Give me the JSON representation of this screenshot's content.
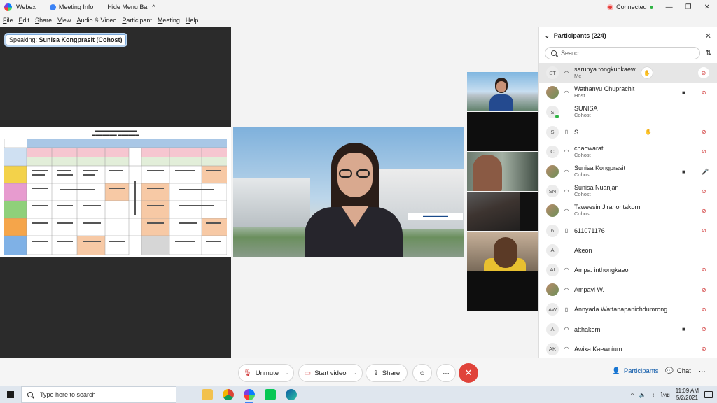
{
  "titlebar": {
    "app_name": "Webex",
    "meeting_info": "Meeting Info",
    "hide_menu_bar": "Hide Menu Bar",
    "status": "Connected",
    "status_color": "#2fb344"
  },
  "menu": [
    "File",
    "Edit",
    "Share",
    "View",
    "Audio & Video",
    "Participant",
    "Meeting",
    "Help"
  ],
  "stage": {
    "speaking_label": "Speaking:",
    "speaking_name": "Sunisa Kongprasit (Cohost)"
  },
  "participants": {
    "header": "Participants (224)",
    "search_placeholder": "Search",
    "items": [
      {
        "initials": "ST",
        "name": "sarunya tongkunkaew",
        "role": "Me",
        "device": "headset",
        "hand": true,
        "video": false,
        "mic": "muted"
      },
      {
        "initials": "",
        "name": "Wathanyu Chuprachit",
        "role": "Host",
        "device": "headset",
        "hand": false,
        "video": true,
        "mic": "muted"
      },
      {
        "initials": "S",
        "name": "SUNISA",
        "role": "Cohost",
        "device": "",
        "hand": false,
        "video": false,
        "mic": "none"
      },
      {
        "initials": "S",
        "name": "S",
        "role": "",
        "device": "phone",
        "hand": true,
        "video": false,
        "mic": "muted"
      },
      {
        "initials": "C",
        "name": "chaowarat",
        "role": "Cohost",
        "device": "headset",
        "hand": false,
        "video": false,
        "mic": "muted"
      },
      {
        "initials": "",
        "name": "Sunisa Kongprasit",
        "role": "Cohost",
        "device": "headset",
        "hand": false,
        "video": true,
        "mic": "on"
      },
      {
        "initials": "SN",
        "name": "Sunisa Nuanjan",
        "role": "Cohost",
        "device": "headset",
        "hand": false,
        "video": false,
        "mic": "muted"
      },
      {
        "initials": "",
        "name": "Taweesin Jiranontakorn",
        "role": "Cohost",
        "device": "headset",
        "hand": false,
        "video": false,
        "mic": "muted"
      },
      {
        "initials": "6",
        "name": "611071176",
        "role": "",
        "device": "phone",
        "hand": false,
        "video": false,
        "mic": "muted"
      },
      {
        "initials": "A",
        "name": "Akeon",
        "role": "",
        "device": "",
        "hand": false,
        "video": false,
        "mic": "none"
      },
      {
        "initials": "AI",
        "name": "Ampa. inthongkaeo",
        "role": "",
        "device": "headset",
        "hand": false,
        "video": false,
        "mic": "muted"
      },
      {
        "initials": "",
        "name": "Ampavi W.",
        "role": "",
        "device": "headset",
        "hand": false,
        "video": false,
        "mic": "muted"
      },
      {
        "initials": "AW",
        "name": "Annyada Wattanapanichdumrong",
        "role": "",
        "device": "phone",
        "hand": false,
        "video": false,
        "mic": "muted"
      },
      {
        "initials": "A",
        "name": "atthakorn",
        "role": "",
        "device": "headset",
        "hand": false,
        "video": true,
        "mic": "muted"
      },
      {
        "initials": "AK",
        "name": "Awika Kaewnium",
        "role": "",
        "device": "headset",
        "hand": false,
        "video": false,
        "mic": "muted"
      }
    ]
  },
  "controls": {
    "unmute": "Unmute",
    "start_video": "Start video",
    "share": "Share",
    "participants": "Participants",
    "chat": "Chat"
  },
  "taskbar": {
    "search_placeholder": "Type here to search",
    "lang": "ไทย",
    "time": "11:09 AM",
    "date": "5/2/2021"
  }
}
